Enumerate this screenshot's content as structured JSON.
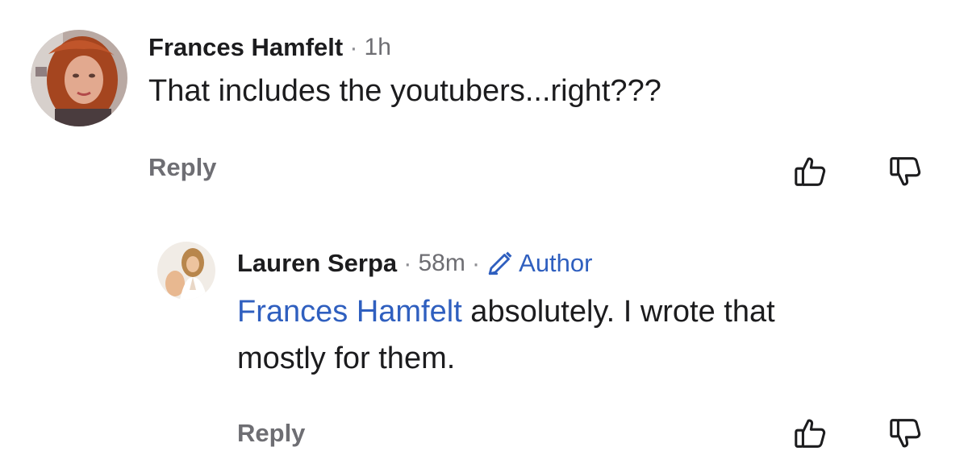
{
  "comments": [
    {
      "author": "Frances Hamfelt",
      "separator": "·",
      "time": "1h",
      "text": "That includes the youtubers...right???",
      "reply_label": "Reply",
      "like_icon": "thumbs-up-icon",
      "dislike_icon": "thumbs-down-icon"
    },
    {
      "author": "Lauren Serpa",
      "separator": "·",
      "time": "58m",
      "separator2": "·",
      "badge": "Author",
      "badge_icon": "pencil-icon",
      "mention": "Frances Hamfelt",
      "text_line1_rest": " absolutely. I wrote that",
      "text_line2": "mostly for them.",
      "reply_label": "Reply",
      "like_icon": "thumbs-up-icon",
      "dislike_icon": "thumbs-down-icon"
    }
  ],
  "colors": {
    "text": "#1c1c1e",
    "muted": "#6e6e73",
    "link": "#2f5fbf"
  }
}
